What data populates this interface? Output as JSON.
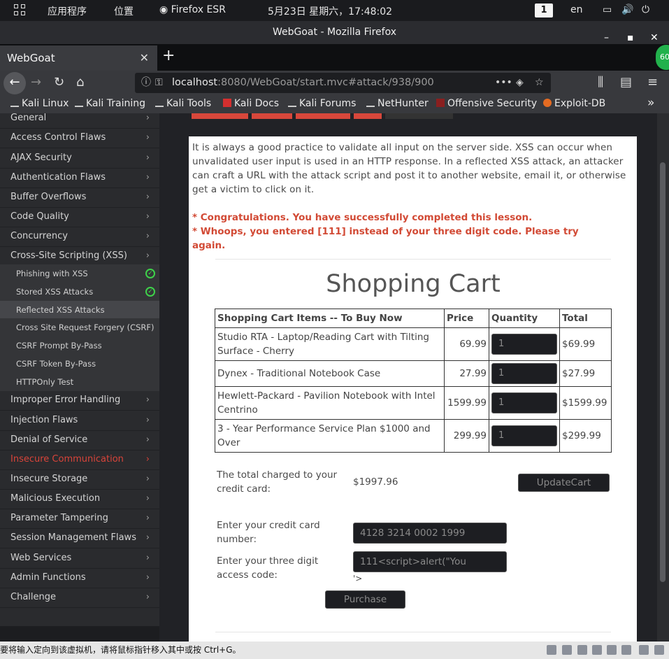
{
  "topbar": {
    "apps": "应用程序",
    "places": "位置",
    "browser": "Firefox ESR",
    "clock": "5月23日 星期六，17:48:02",
    "workspace": "1",
    "lang": "en"
  },
  "window": {
    "title": "WebGoat - Mozilla Firefox"
  },
  "tab": {
    "title": "WebGoat"
  },
  "ext_badge": "60",
  "url": {
    "host": "localhost",
    "rest": ":8080/WebGoat/start.mvc#attack/938/900"
  },
  "bookmarks": [
    "Kali Linux",
    "Kali Training",
    "Kali Tools",
    "Kali Docs",
    "Kali Forums",
    "NetHunter",
    "Offensive Security",
    "Exploit-DB"
  ],
  "sidebar": {
    "items": [
      "General",
      "Access Control Flaws",
      "AJAX Security",
      "Authentication Flaws",
      "Buffer Overflows",
      "Code Quality",
      "Concurrency",
      "Cross-Site Scripting (XSS)"
    ],
    "subitems": [
      "Phishing with XSS",
      "Stored XSS Attacks",
      "Reflected XSS Attacks",
      "Cross Site Request Forgery (CSRF)",
      "CSRF Prompt By-Pass",
      "CSRF Token By-Pass",
      "HTTPOnly Test"
    ],
    "items2": [
      "Improper Error Handling",
      "Injection Flaws",
      "Denial of Service",
      "Insecure Communication",
      "Insecure Storage",
      "Malicious Execution",
      "Parameter Tampering",
      "Session Management Flaws",
      "Web Services",
      "Admin Functions",
      "Challenge"
    ]
  },
  "lesson": {
    "intro": "It is always a good practice to validate all input on the server side. XSS can occur when unvalidated user input is used in an HTTP response. In a reflected XSS attack, an attacker can craft a URL with the attack script and post it to another website, email it, or otherwise get a victim to click on it.",
    "msg1": "* Congratulations. You have successfully completed this lesson.",
    "msg2": "* Whoops, you entered [111] instead of your three digit code. Please try again."
  },
  "cart": {
    "title": "Shopping Cart",
    "headers": [
      "Shopping Cart Items -- To Buy Now",
      "Price",
      "Quantity",
      "Total"
    ],
    "rows": [
      {
        "item": "Studio RTA - Laptop/Reading Cart with Tilting Surface - Cherry",
        "price": "69.99",
        "qty": "1",
        "total": "$69.99"
      },
      {
        "item": "Dynex - Traditional Notebook Case",
        "price": "27.99",
        "qty": "1",
        "total": "$27.99"
      },
      {
        "item": "Hewlett-Packard - Pavilion Notebook with Intel Centrino",
        "price": "1599.99",
        "qty": "1",
        "total": "$1599.99"
      },
      {
        "item": "3 - Year Performance Service Plan $1000 and Over",
        "price": "299.99",
        "qty": "1",
        "total": "$299.99"
      }
    ],
    "total_label": "The total charged to your credit card:",
    "total_value": "$1997.96",
    "update_button": "UpdateCart",
    "cc_label": "Enter your credit card number:",
    "cc_value": "4128 3214 0002 1999",
    "code_label": "Enter your three digit access code:",
    "code_value": "111<script>alert(\"You",
    "code_overflow": "'>",
    "purchase_button": "Purchase"
  },
  "status": {
    "text": "要将输入定向到该虚拟机，请将鼠标指针移入其中或按 Ctrl+G。"
  }
}
